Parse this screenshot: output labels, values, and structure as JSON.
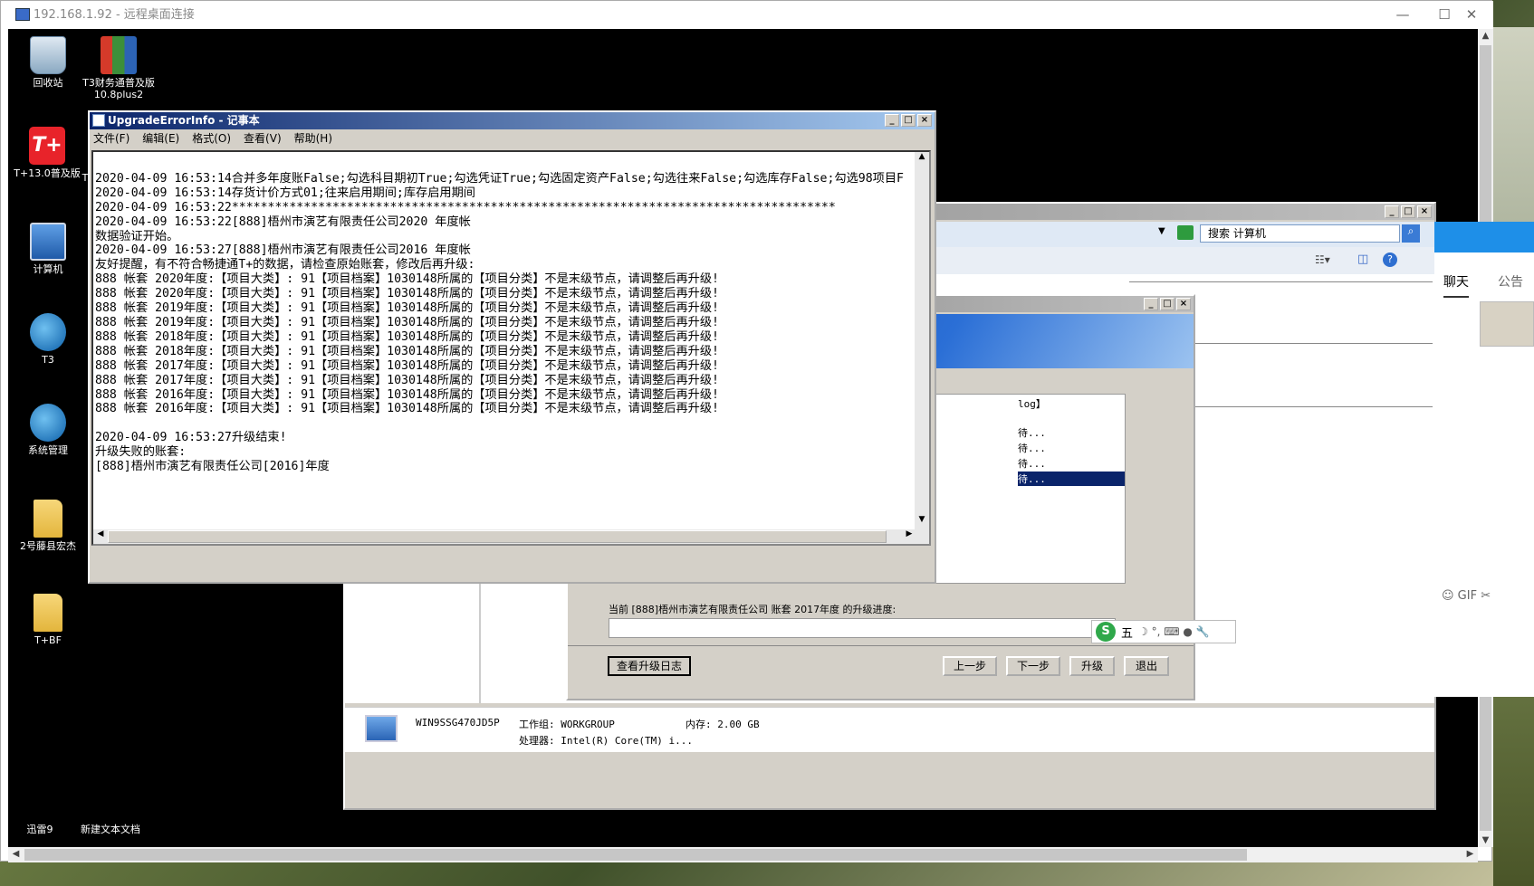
{
  "rdp": {
    "title": "192.168.1.92 - 远程桌面连接",
    "min": "—",
    "max": "☐",
    "close": "✕"
  },
  "desktop": {
    "icons": [
      {
        "label": "回收站"
      },
      {
        "label": "T3财务通普及版10.8plus2"
      },
      {
        "label": "T+13.0普及版"
      },
      {
        "label": "计算机"
      },
      {
        "label": "T3"
      },
      {
        "label": "系统管理"
      },
      {
        "label": "2号藤县宏杰"
      },
      {
        "label": "T+BF"
      }
    ],
    "bottom_icons": [
      "迅雷9",
      "新建文本文档"
    ],
    "partial_label": "T"
  },
  "notepad": {
    "title": "UpgradeErrorInfo - 记事本",
    "menu": [
      "文件(F)",
      "编辑(E)",
      "格式(O)",
      "查看(V)",
      "帮助(H)"
    ],
    "lines": [
      "",
      "2020-04-09 16:53:14合并多年度账False;勾选科目期初True;勾选凭证True;勾选固定资产False;勾选往来False;勾选库存False;勾选98项目F",
      "2020-04-09 16:53:14存货计价方式01;往来启用期间;库存启用期间",
      "2020-04-09 16:53:22************************************************************************************",
      "2020-04-09 16:53:22[888]梧州市演艺有限责任公司2020 年度帐",
      "数据验证开始。",
      "2020-04-09 16:53:27[888]梧州市演艺有限责任公司2016 年度帐",
      "友好提醒，有不符合畅捷通T+的数据，请检查原始账套，修改后再升级:",
      "888 帐套 2020年度:【项目大类】: 91【项目档案】1030148所属的【项目分类】不是末级节点，请调整后再升级!",
      "888 帐套 2020年度:【项目大类】: 91【项目档案】1030148所属的【项目分类】不是末级节点，请调整后再升级!",
      "888 帐套 2019年度:【项目大类】: 91【项目档案】1030148所属的【项目分类】不是末级节点，请调整后再升级!",
      "888 帐套 2019年度:【项目大类】: 91【项目档案】1030148所属的【项目分类】不是末级节点，请调整后再升级!",
      "888 帐套 2018年度:【项目大类】: 91【项目档案】1030148所属的【项目分类】不是末级节点，请调整后再升级!",
      "888 帐套 2018年度:【项目大类】: 91【项目档案】1030148所属的【项目分类】不是末级节点，请调整后再升级!",
      "888 帐套 2017年度:【项目大类】: 91【项目档案】1030148所属的【项目分类】不是末级节点，请调整后再升级!",
      "888 帐套 2017年度:【项目大类】: 91【项目档案】1030148所属的【项目分类】不是末级节点，请调整后再升级!",
      "888 帐套 2016年度:【项目大类】: 91【项目档案】1030148所属的【项目分类】不是末级节点，请调整后再升级!",
      "888 帐套 2016年度:【项目大类】: 91【项目档案】1030148所属的【项目分类】不是末级节点，请调整后再升级!",
      "",
      "2020-04-09 16:53:27升级结束!",
      "升级失败的账套:",
      "[888]梧州市演艺有限责任公司[2016]年度"
    ]
  },
  "explorer": {
    "search_placeholder": "搜索 计算机",
    "computer_name": "WIN9SSG470JD5P",
    "workgroup": "工作组: WORKGROUP",
    "memory": "内存: 2.00 GB",
    "processor": "处理器: Intel(R) Core(TM) i..."
  },
  "upgrade": {
    "list_header_partial": "log】",
    "list_items": [
      "待...",
      "待...",
      "待...",
      "待..."
    ],
    "progress_label": "当前 [888]梧州市演艺有限责任公司 账套 2017年度 的升级进度:",
    "btn_log": "查看升级日志",
    "btn_prev": "上一步",
    "btn_next": "下一步",
    "btn_upgrade": "升级",
    "btn_exit": "退出"
  },
  "ime": {
    "logo": "S",
    "mode": "五",
    "icons": "☽ °, ⌨ ● 🔧"
  },
  "chat": {
    "tab_chat": "聊天",
    "tab_notice": "公告",
    "tool_icons": "☺ GIF ✂"
  }
}
